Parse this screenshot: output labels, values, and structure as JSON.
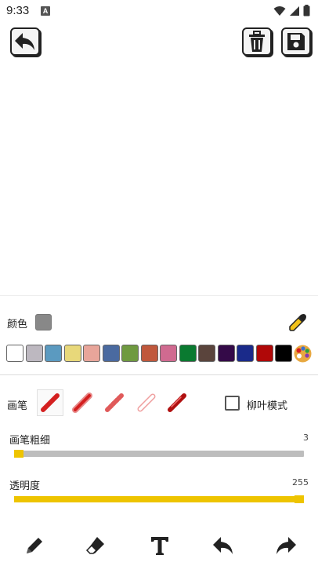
{
  "status_bar": {
    "time": "9:33",
    "notification_badge": "A"
  },
  "colors": {
    "accent": "#eec400",
    "current_color": "#888888",
    "brush_red": "#d42020"
  },
  "color_panel": {
    "label": "颜色",
    "palette": [
      "#ffffff",
      "#bdb8c0",
      "#5b9ac0",
      "#e8d87a",
      "#e8a59a",
      "#4a6aa0",
      "#6f9a40",
      "#c0583c",
      "#d06a90",
      "#0a7a30",
      "#5a443c",
      "#340a48",
      "#1a2a8a",
      "#b00808",
      "#000000"
    ]
  },
  "brush_panel": {
    "label": "画笔",
    "brushes": [
      "solid",
      "soft",
      "dashed",
      "outline",
      "marker"
    ],
    "selected": "solid",
    "willow_mode_label": "柳叶模式",
    "willow_mode_checked": false
  },
  "thickness": {
    "label": "画笔粗细",
    "value": "3",
    "max": 255
  },
  "opacity": {
    "label": "透明度",
    "value": "255",
    "max": 255
  },
  "bottom_toolbar": [
    "pencil",
    "eraser",
    "text",
    "undo",
    "redo"
  ]
}
